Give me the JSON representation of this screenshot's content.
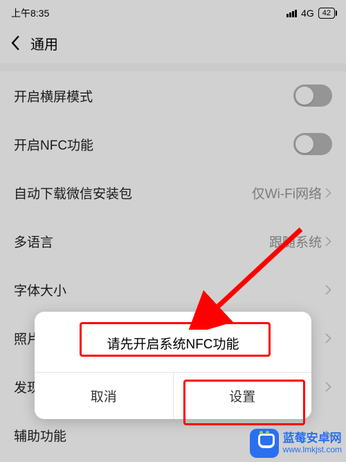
{
  "status": {
    "time": "上午8:35",
    "net": "4G",
    "battery": "42"
  },
  "header": {
    "title": "通用"
  },
  "rows": {
    "landscape": {
      "label": "开启横屏模式"
    },
    "nfc": {
      "label": "开启NFC功能"
    },
    "autodl": {
      "label": "自动下载微信安装包",
      "value": "仅Wi-Fi网络"
    },
    "lang": {
      "label": "多语言",
      "value": "跟随系统"
    },
    "fontsize": {
      "label": "字体大小"
    },
    "photos": {
      "label": "照片"
    },
    "discovery": {
      "label": "发现"
    },
    "accessibility": {
      "label": "辅助功能"
    }
  },
  "dialog": {
    "message": "请先开启系统NFC功能",
    "cancel": "取消",
    "confirm": "设置"
  },
  "watermark": {
    "name": "蓝莓安卓网",
    "url": "www.lmkjst.com"
  }
}
